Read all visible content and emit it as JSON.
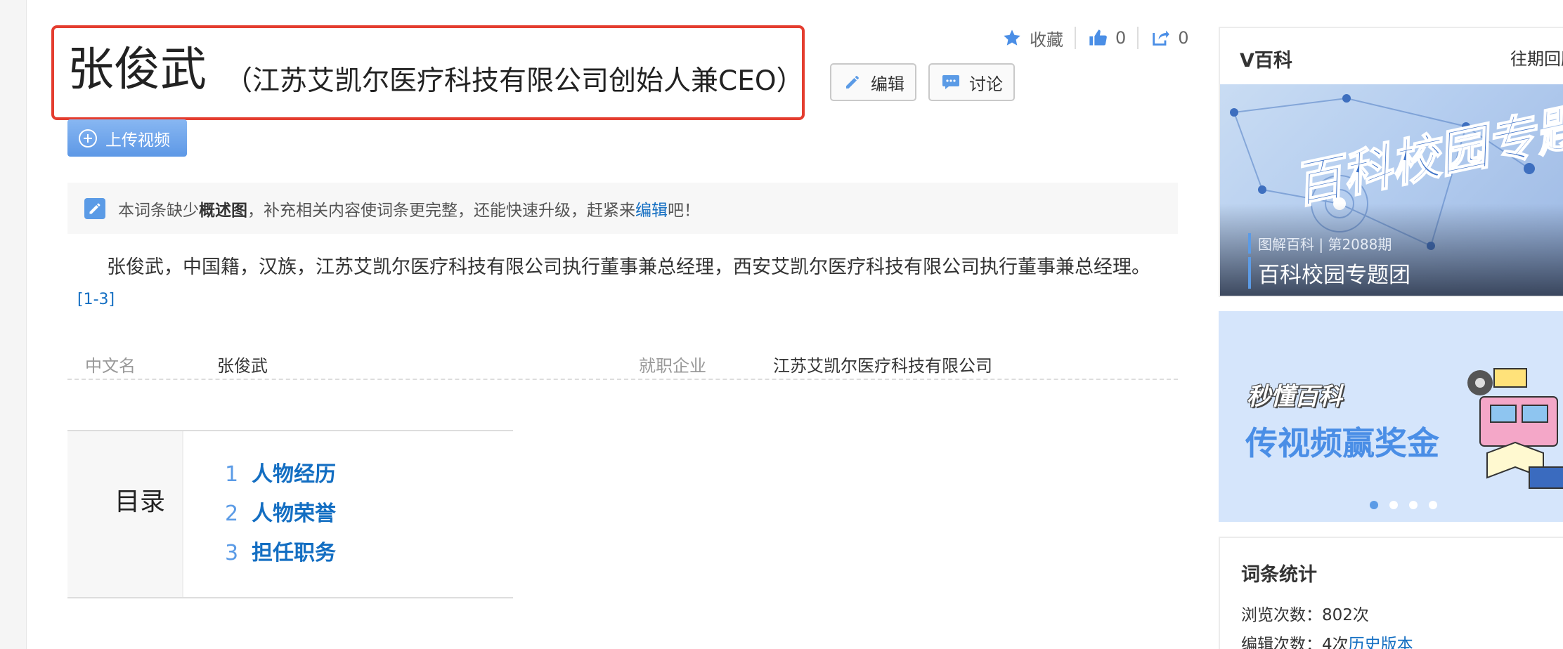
{
  "title": {
    "name": "张俊武",
    "subtitle": "（江苏艾凯尔医疗科技有限公司创始人兼CEO）"
  },
  "actions": {
    "collect": "收藏",
    "like_count": "0",
    "share_count": "0",
    "edit": "编辑",
    "discuss": "讨论",
    "upload_video": "上传视频"
  },
  "notice": {
    "pre": "本词条缺少",
    "bold": "概述图",
    "mid": "，补充相关内容使词条更完整，还能快速升级，赶紧来",
    "link": "编辑",
    "post": "吧！"
  },
  "summary": {
    "text": "张俊武，中国籍，汉族，江苏艾凯尔医疗科技有限公司执行董事兼总经理，西安艾凯尔医疗科技有限公司执行董事兼总经理。",
    "ref": "[1-3]"
  },
  "basic_info": [
    {
      "label": "中文名",
      "value": "张俊武"
    },
    {
      "label": "就职企业",
      "value": "江苏艾凯尔医疗科技有限公司"
    }
  ],
  "catalog": {
    "title": "目录",
    "items": [
      {
        "num": "1",
        "text": "人物经历"
      },
      {
        "num": "2",
        "text": "人物荣誉"
      },
      {
        "num": "3",
        "text": "担任职务"
      }
    ]
  },
  "sidebar": {
    "vbaike": {
      "title": "V百科",
      "more": "往期回顾",
      "banner_text": "百科校园专题团",
      "period": "图解百科 | 第2088期",
      "name": "百科校园专题团"
    },
    "promo": {
      "brand": "秒懂百科",
      "slogan": "传视频赢奖金",
      "dots": 4,
      "active_dot": 0
    },
    "stats": {
      "title": "词条统计",
      "views_label": "浏览次数：",
      "views": "802次",
      "edits_label": "编辑次数：",
      "edits": "4次",
      "history_link": "历史版本"
    }
  },
  "colors": {
    "accent": "#136ec2",
    "highlight_border": "#e43d2f",
    "icon_blue": "#5b9be6"
  }
}
